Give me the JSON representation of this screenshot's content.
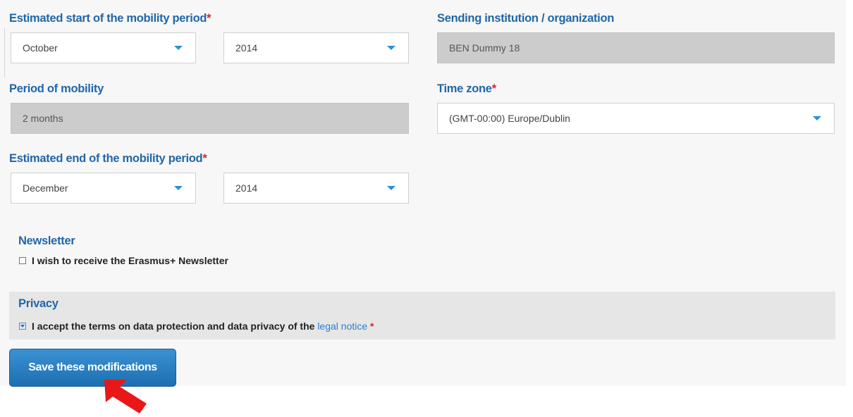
{
  "start": {
    "label": "Estimated start of the mobility period",
    "required": "*",
    "month": "October",
    "year": "2014"
  },
  "sending": {
    "label": "Sending institution / organization",
    "value": "BEN Dummy 18"
  },
  "period": {
    "label": "Period of mobility",
    "value": "2 months"
  },
  "timezone": {
    "label": "Time zone",
    "required": "*",
    "value": "(GMT-00:00) Europe/Dublin"
  },
  "end": {
    "label": "Estimated end of the mobility period",
    "required": "*",
    "month": "December",
    "year": "2014"
  },
  "newsletter": {
    "title": "Newsletter",
    "checkbox_label": "I wish to receive the Erasmus+ Newsletter",
    "checked": false
  },
  "privacy": {
    "title": "Privacy",
    "text": "I accept the terms on data protection and data privacy of the",
    "link": "legal notice",
    "required": "*",
    "checked": true
  },
  "save_button": "Save these modifications",
  "colors": {
    "label_blue": "#2266a8",
    "required_red": "#e0202a",
    "caret_blue": "#2a8fd6",
    "button_blue": "#1d6fb0",
    "arrow_red": "#e81818"
  },
  "icons": {
    "dropdown": "caret-down-icon",
    "pointer": "red-arrow-icon"
  }
}
